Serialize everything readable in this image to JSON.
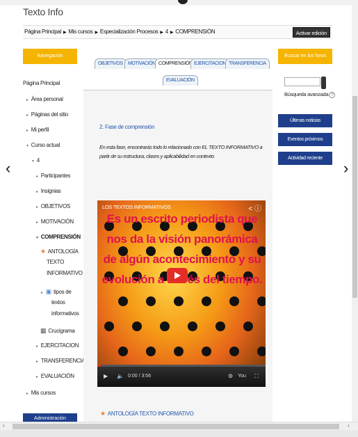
{
  "page": {
    "site_title": "Texto Info",
    "edit_button": "Activar edición",
    "prev_arrow": "‹",
    "next_arrow": "›"
  },
  "breadcrumb": [
    "Página Principal",
    "Mis cursos",
    "Especialización Procesos",
    "4",
    "COMPRENSIÓN"
  ],
  "breadcrumb_separator": "▶",
  "navigation": {
    "title": "Navegación",
    "home": "Página Principal",
    "items": [
      {
        "label": "Área personal",
        "marker": "▸"
      },
      {
        "label": "Páginas del sitio",
        "marker": "▸"
      },
      {
        "label": "Mi perfil",
        "marker": "▸"
      },
      {
        "label": "Curso actual",
        "marker": "▾"
      },
      {
        "label": "4",
        "marker": "▾"
      },
      {
        "label": "Participantes",
        "marker": "▸"
      },
      {
        "label": "Insignias",
        "marker": "▸"
      },
      {
        "label": "OBJETIVOS",
        "marker": "▸"
      },
      {
        "label": "MOTIVACIÓN",
        "marker": "▸"
      },
      {
        "label": "COMPRENSIÓN",
        "marker": "▾"
      },
      {
        "label": "ANTOLOGÍA",
        "marker": ""
      },
      {
        "label": "TEXTO",
        "marker": ""
      },
      {
        "label": "INFORMATIVO",
        "marker": ""
      },
      {
        "label": "tipos de",
        "marker": "▸"
      },
      {
        "label": "textos",
        "marker": ""
      },
      {
        "label": "informativos",
        "marker": ""
      },
      {
        "label": "Crucigrama",
        "marker": ""
      },
      {
        "label": "EJERCITACION",
        "marker": "▸"
      },
      {
        "label": "TRANSFERENCIA",
        "marker": "▸"
      },
      {
        "label": "EVALUACIÓN",
        "marker": "▸"
      },
      {
        "label": "Mis cursos",
        "marker": "▸"
      }
    ],
    "admin_title": "Administración"
  },
  "tabs": [
    {
      "label": "OBJETIVOS",
      "active": false
    },
    {
      "label": "MOTIVACIÓN",
      "active": false
    },
    {
      "label": "COMPRENSIÓN",
      "active": true
    },
    {
      "label": "EJERCITACION",
      "active": false
    },
    {
      "label": "TRANSFERENCIA",
      "active": false
    },
    {
      "label": "EVALUACIÓN",
      "active": false
    }
  ],
  "content": {
    "phase_title": "2. Fase de comprensión",
    "phase_text": "En esta fase, encontrarás todo lo relacionado con EL TEXTO INFORMATIVO a partir de su estructura, clases y aplicabilidad en contexto",
    "video_title": "LOS TEXTOS INFORMATIVOS",
    "video_caption": "Es un escrito periodista que nos da la visión panorámica de algún acontecimiento y su evolución a través del tiempo.",
    "video_time": "0:00 / 3:56",
    "video_progress": 0.02,
    "antologia_link": "ANTOLOGÍA TEXTO INFORMATIVO"
  },
  "search": {
    "title": "Buscar en los foros",
    "advanced": "Búsqueda avanzada"
  },
  "blocks": [
    "Últimas noticias",
    "Eventos próximos",
    "Actividad reciente"
  ]
}
